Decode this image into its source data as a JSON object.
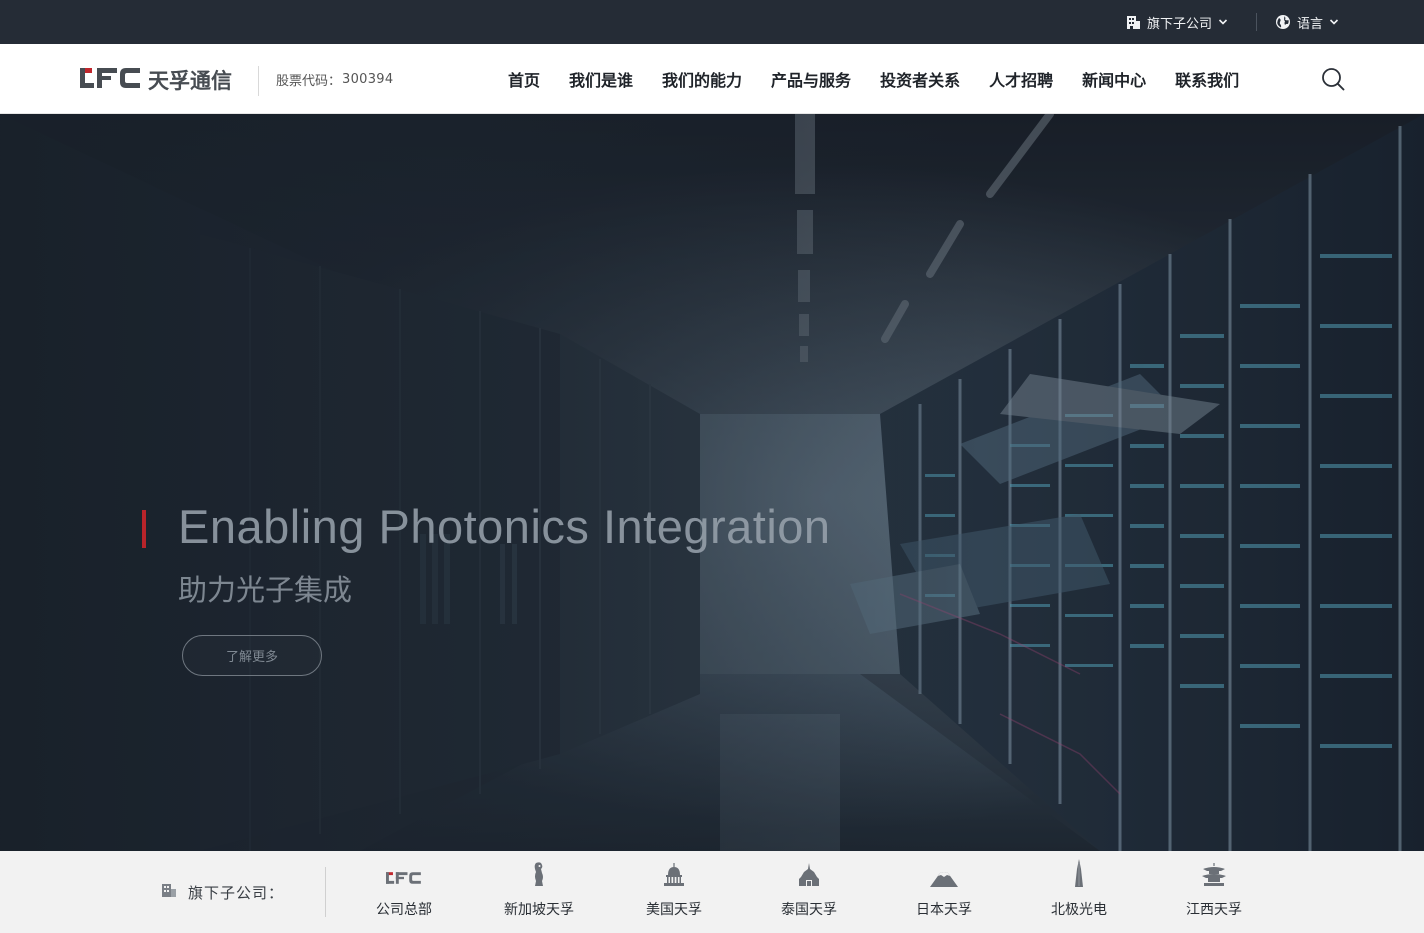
{
  "topbar": {
    "subsidiaries_label": "旗下子公司",
    "language_label": "语言"
  },
  "header": {
    "logo_text": "天孚通信",
    "stock_label": "股票代码：",
    "stock_code": "300394",
    "nav": [
      "首页",
      "我们是谁",
      "我们的能力",
      "产品与服务",
      "投资者关系",
      "人才招聘",
      "新闻中心",
      "联系我们"
    ]
  },
  "hero": {
    "title": "Enabling Photonics Integration",
    "subtitle": "助力光子集成",
    "cta_label": "了解更多",
    "progress": 0.33
  },
  "subsidiaries": {
    "label": "旗下子公司：",
    "items": [
      {
        "name": "公司总部",
        "icon": "tfc-logo-icon"
      },
      {
        "name": "新加坡天孚",
        "icon": "merlion-icon"
      },
      {
        "name": "美国天孚",
        "icon": "capitol-icon"
      },
      {
        "name": "泰国天孚",
        "icon": "thai-temple-icon"
      },
      {
        "name": "日本天孚",
        "icon": "mount-fuji-icon"
      },
      {
        "name": "北极光电",
        "icon": "spire-icon"
      },
      {
        "name": "江西天孚",
        "icon": "pavilion-icon"
      }
    ]
  },
  "colors": {
    "topbar": "#252c36",
    "brand_red": "#c0272d",
    "brand_gray": "#474c52",
    "strip_bg": "#f2f2f2"
  }
}
